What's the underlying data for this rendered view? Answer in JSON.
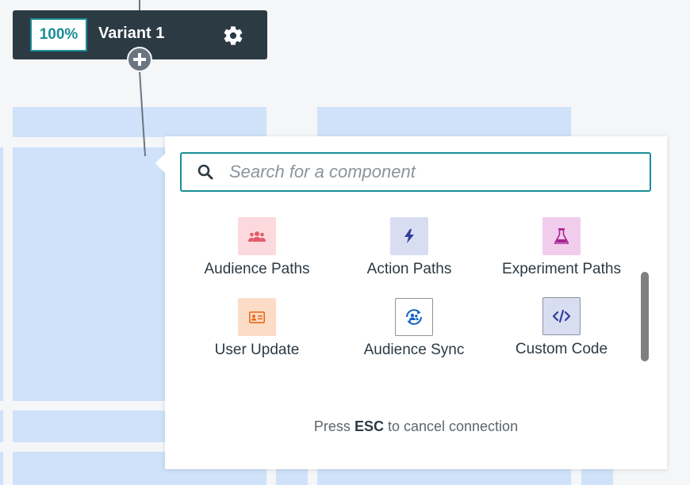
{
  "variant": {
    "percent": "100%",
    "name": "Variant 1"
  },
  "icons": {
    "settings": "gear-icon",
    "add": "plus-circle-icon",
    "search": "search-icon"
  },
  "popover": {
    "search": {
      "placeholder": "Search for a component",
      "value": ""
    },
    "components": [
      {
        "label": "Audience Paths",
        "icon": "people-icon",
        "color": "#e35b6a"
      },
      {
        "label": "Action Paths",
        "icon": "bolt-icon",
        "color": "#2f3f9a"
      },
      {
        "label": "Experiment Paths",
        "icon": "flask-icon",
        "color": "#a5258f"
      },
      {
        "label": "User Update",
        "icon": "id-card-icon",
        "color": "#e86a1e"
      },
      {
        "label": "Audience Sync",
        "icon": "sync-people-icon",
        "color": "#1764c5"
      },
      {
        "label": "Custom Code",
        "icon": "code-icon",
        "color": "#2f3f9a"
      }
    ],
    "hint": {
      "prefix": "Press",
      "key": "ESC",
      "suffix": "to cancel connection"
    }
  },
  "colors": {
    "accent": "#1a8e97",
    "node_background": "#2c3a44",
    "canvas_block": "#cfe2fa"
  }
}
